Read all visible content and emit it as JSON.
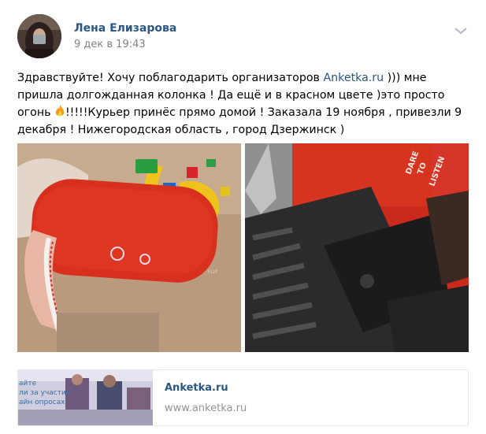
{
  "post": {
    "author": "Лена Елизарова",
    "date": "9 дек в 19:43",
    "text_before_link": "Здравствуйте! Хочу поблагодарить организаторов ",
    "text_link": "Anketka.ru",
    "text_mid": " ))) мне пришла долгожданная колонка ! Да ещё и в красном цвете )это просто огонь ",
    "text_after_icon": "!!!!!Курьер принёс прямо домой ! Заказала 19 ноября , привезли 9 декабря ! Нижегородская область , город Дзержинск )",
    "icons": {
      "menu": "chevron-down-icon",
      "emoji": "fire-icon"
    }
  },
  "photos": {
    "left": {
      "speaker_text": "FLIP"
    },
    "right": {
      "box_text": [
        "DARE",
        "TO",
        "LISTEN"
      ]
    }
  },
  "link_card": {
    "title": "Anketka.ru",
    "url": "www.anketka.ru",
    "thumb_lines": [
      "айте",
      "ли за участие",
      "айн опросах"
    ]
  },
  "colors": {
    "link": "#2a5885",
    "meta": "#828282",
    "speaker_red": "#d8301e"
  }
}
